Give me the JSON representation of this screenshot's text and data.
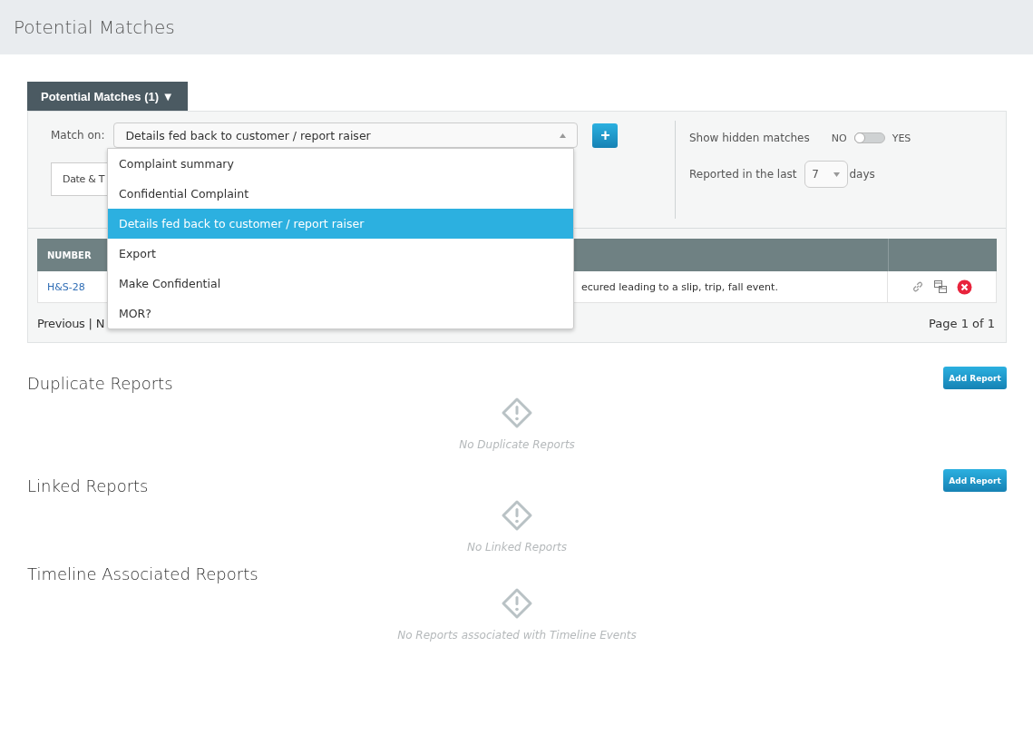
{
  "page_title": "Potential Matches",
  "panel_tab": {
    "label": "Potential Matches (1) ▼",
    "selected": true
  },
  "match_on": {
    "label": "Match on:",
    "value": "Details fed back to customer / report raiser",
    "expanded": true,
    "options": [
      {
        "label": "Complaint summary",
        "selected": false
      },
      {
        "label": "Confidential Complaint",
        "selected": false
      },
      {
        "label": "Details fed back to customer / report raiser",
        "selected": true
      },
      {
        "label": "Export",
        "selected": false
      },
      {
        "label": "Make Confidential",
        "selected": false
      },
      {
        "label": "MOR?",
        "selected": false
      }
    ]
  },
  "add_button": "+",
  "date_button": "Date & T",
  "show_hidden": {
    "label": "Show hidden matches",
    "off_label": "NO",
    "on_label": "YES",
    "on": false
  },
  "reported": {
    "label": "Reported in the last",
    "value": "7",
    "unit": "days"
  },
  "table": {
    "columns": [
      "NUMBER"
    ],
    "rows": [
      {
        "number": "H&S-28",
        "description": "ecured leading to a slip, trip, fall event."
      }
    ]
  },
  "pagination": {
    "previous": "Previous",
    "separator": "|",
    "next": "N",
    "page": "Page 1 of 1"
  },
  "sections": [
    {
      "title": "Duplicate Reports",
      "button": "Add Report",
      "empty_text": "No Duplicate Reports"
    },
    {
      "title": "Linked Reports",
      "button": "Add Report",
      "empty_text": "No Linked Reports"
    },
    {
      "title": "Timeline Associated Reports",
      "empty_text": "No Reports associated with Timeline Events"
    }
  ]
}
